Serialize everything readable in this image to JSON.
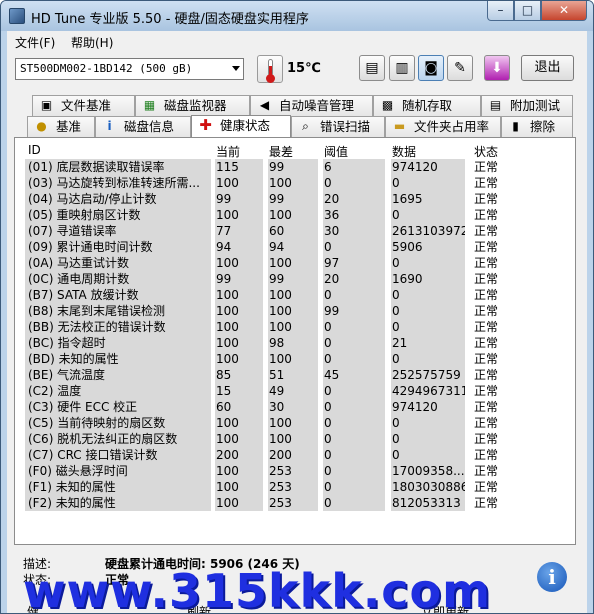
{
  "window": {
    "title": "HD Tune 专业版 5.50 - 硬盘/固态硬盘实用程序",
    "min": "–",
    "max": "□",
    "close": "✕"
  },
  "menu": {
    "file": "文件(F)",
    "help": "帮助(H)"
  },
  "toolbar": {
    "drive": "ST500DM002-1BD142 (500 gB)",
    "temperature": "15℃",
    "exit": "退出",
    "icons": [
      "copy-text-icon",
      "copy-info-icon",
      "screenshot-camera-icon",
      "options-wrench-icon",
      "save-download-icon"
    ]
  },
  "tabs_top": [
    {
      "label": "文件基准",
      "icon": "document-icon"
    },
    {
      "label": "磁盘监视器",
      "icon": "monitor-chart-icon"
    },
    {
      "label": "自动噪音管理",
      "icon": "speaker-icon"
    },
    {
      "label": "随机存取",
      "icon": "random-access-icon"
    },
    {
      "label": "附加测试",
      "icon": "extra-tests-icon"
    }
  ],
  "tabs_bottom": [
    {
      "label": "基准",
      "icon": "lightbulb-icon"
    },
    {
      "label": "磁盘信息",
      "icon": "info-icon"
    },
    {
      "label": "健康状态",
      "icon": "health-cross-icon",
      "active": true
    },
    {
      "label": "错误扫描",
      "icon": "search-icon"
    },
    {
      "label": "文件夹占用率",
      "icon": "folder-icon"
    },
    {
      "label": "擦除",
      "icon": "trash-icon"
    }
  ],
  "table": {
    "headers": [
      "ID",
      "当前",
      "最差",
      "阈值",
      "数据",
      "状态"
    ],
    "rows": [
      {
        "id": "(01) 底层数据读取错误率",
        "cur": "115",
        "worst": "99",
        "thr": "6",
        "data": "974120",
        "status": "正常"
      },
      {
        "id": "(03) 马达旋转到标准转速所需...",
        "cur": "100",
        "worst": "100",
        "thr": "0",
        "data": "0",
        "status": "正常"
      },
      {
        "id": "(04) 马达启动/停止计数",
        "cur": "99",
        "worst": "99",
        "thr": "20",
        "data": "1695",
        "status": "正常"
      },
      {
        "id": "(05) 重映射扇区计数",
        "cur": "100",
        "worst": "100",
        "thr": "36",
        "data": "0",
        "status": "正常"
      },
      {
        "id": "(07) 寻道错误率",
        "cur": "77",
        "worst": "60",
        "thr": "30",
        "data": "26131039729",
        "status": "正常"
      },
      {
        "id": "(09) 累计通电时间计数",
        "cur": "94",
        "worst": "94",
        "thr": "0",
        "data": "5906",
        "status": "正常"
      },
      {
        "id": "(0A) 马达重试计数",
        "cur": "100",
        "worst": "100",
        "thr": "97",
        "data": "0",
        "status": "正常"
      },
      {
        "id": "(0C) 通电周期计数",
        "cur": "99",
        "worst": "99",
        "thr": "20",
        "data": "1690",
        "status": "正常"
      },
      {
        "id": "(B7) SATA 放缓计数",
        "cur": "100",
        "worst": "100",
        "thr": "0",
        "data": "0",
        "status": "正常"
      },
      {
        "id": "(B8) 末尾到末尾错误检测",
        "cur": "100",
        "worst": "100",
        "thr": "99",
        "data": "0",
        "status": "正常"
      },
      {
        "id": "(BB) 无法校正的错误计数",
        "cur": "100",
        "worst": "100",
        "thr": "0",
        "data": "0",
        "status": "正常"
      },
      {
        "id": "(BC) 指令超时",
        "cur": "100",
        "worst": "98",
        "thr": "0",
        "data": "21",
        "status": "正常"
      },
      {
        "id": "(BD) 未知的属性",
        "cur": "100",
        "worst": "100",
        "thr": "0",
        "data": "0",
        "status": "正常"
      },
      {
        "id": "(BE) 气流温度",
        "cur": "85",
        "worst": "51",
        "thr": "45",
        "data": "252575759",
        "status": "正常"
      },
      {
        "id": "(C2) 温度",
        "cur": "15",
        "worst": "49",
        "thr": "0",
        "data": "4294967311",
        "status": "正常"
      },
      {
        "id": "(C3) 硬件 ECC 校正",
        "cur": "60",
        "worst": "30",
        "thr": "0",
        "data": "974120",
        "status": "正常"
      },
      {
        "id": "(C5) 当前待映射的扇区数",
        "cur": "100",
        "worst": "100",
        "thr": "0",
        "data": "0",
        "status": "正常"
      },
      {
        "id": "(C6) 脱机无法纠正的扇区数",
        "cur": "100",
        "worst": "100",
        "thr": "0",
        "data": "0",
        "status": "正常"
      },
      {
        "id": "(C7) CRC 接口错误计数",
        "cur": "200",
        "worst": "200",
        "thr": "0",
        "data": "0",
        "status": "正常"
      },
      {
        "id": "(F0) 磁头悬浮时间",
        "cur": "100",
        "worst": "253",
        "thr": "0",
        "data": "17009358...",
        "status": "正常"
      },
      {
        "id": "(F1) 未知的属性",
        "cur": "100",
        "worst": "253",
        "thr": "0",
        "data": "1803030886",
        "status": "正常"
      },
      {
        "id": "(F2) 未知的属性",
        "cur": "100",
        "worst": "253",
        "thr": "0",
        "data": "812053313",
        "status": "正常"
      }
    ]
  },
  "footer": {
    "desc_label": "描述:",
    "desc_value": "硬盘累计通电时间: 5906 (246 天)",
    "state_label": "状态:",
    "state_value": "正常",
    "partial_left": "健",
    "partial_mid": "刷新",
    "partial_right": "立即更新"
  },
  "watermark": "www.315kkk.com",
  "colors": {
    "watermark": "#1f2fe0",
    "shade": "#d9d9d9",
    "titlebar": "#bcd3ea"
  }
}
